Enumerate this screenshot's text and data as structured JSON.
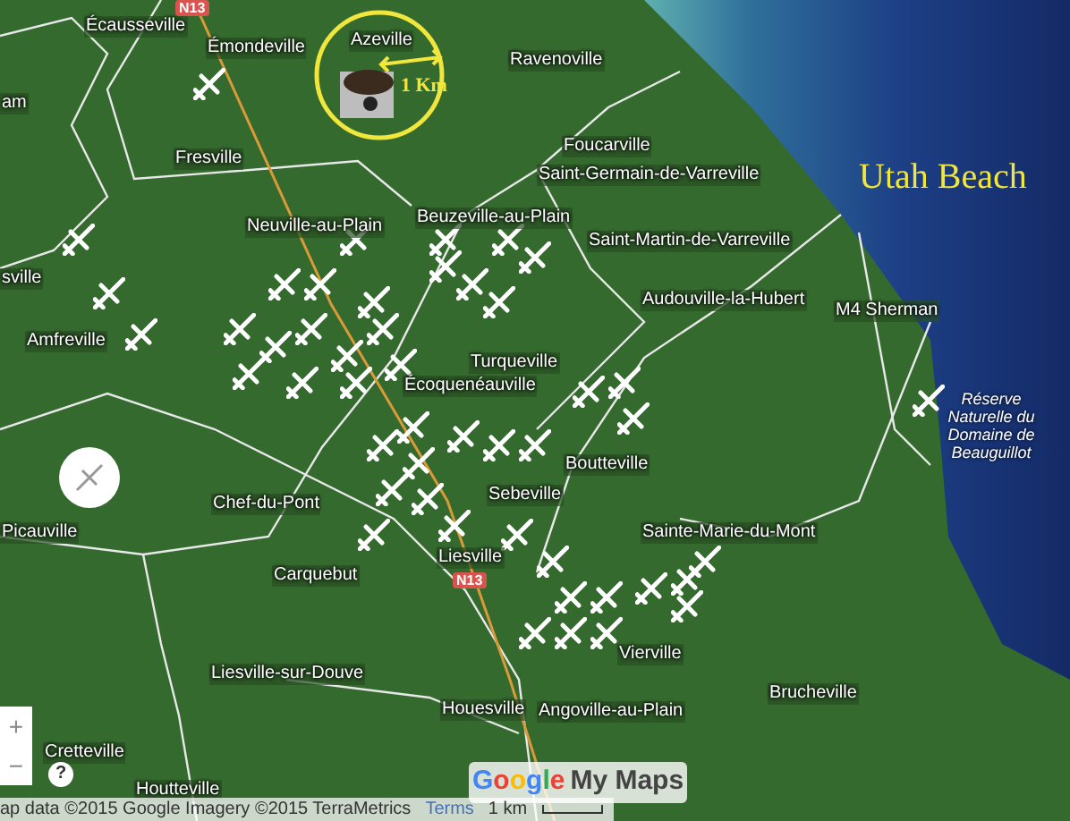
{
  "map": {
    "places": [
      "am",
      "Écausseville",
      "Émondeville",
      "Azeville",
      "Ravenoville",
      "Fresville",
      "Foucarville",
      "Saint-Germain-de-Varreville",
      "Neuville-au-Plain",
      "Beuzeville-au-Plain",
      "Saint-Martin-de-Varreville",
      "sville",
      "Audouville-la-Hubert",
      "M4 Sherman",
      "Amfreville",
      "Turqueville",
      "Écoquenéauville",
      "Réserve Naturelle du Domaine de Beauguillot",
      "Boutteville",
      "Chef-du-Pont",
      "Sebeville",
      "Picauville",
      "Sainte-Marie-du-Mont",
      "Liesville",
      "Carquebut",
      "Vierville",
      "Liesville-sur-Douve",
      "Brucheville",
      "Houesville",
      "Angoville-au-Plain",
      "Cretteville",
      "Houtteville"
    ],
    "sea_label": "Utah Beach",
    "route_shields": [
      "N13",
      "N13"
    ],
    "scale_marker": {
      "label": "1 Km"
    },
    "zoom_controls": [
      "+",
      "−"
    ],
    "help": "?",
    "logo": {
      "brand": [
        "G",
        "o",
        "o",
        "g",
        "l",
        "e"
      ],
      "product": "My Maps"
    },
    "attribution": "ap data ©2015 Google Imagery ©2015 TerraMetrics",
    "terms": "Terms",
    "scale": "1 km"
  }
}
